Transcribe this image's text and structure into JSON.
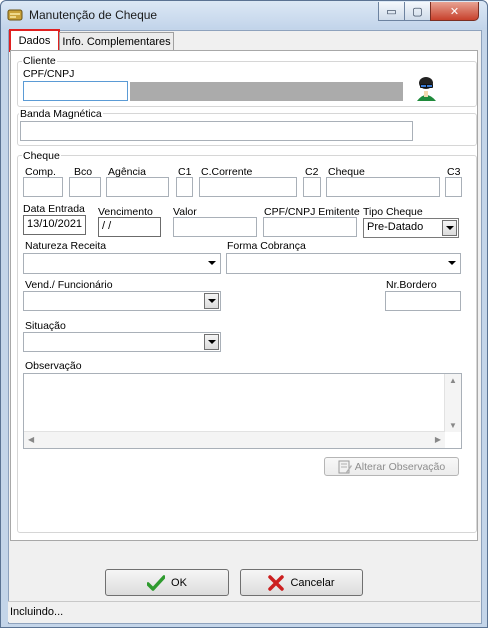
{
  "window": {
    "title": "Manutenção de Cheque",
    "min_glyph": "▭",
    "max_glyph": "▢",
    "close_glyph": "✕"
  },
  "tabs": [
    {
      "label": "Dados",
      "active": true
    },
    {
      "label": "Info. Complementares",
      "active": false
    }
  ],
  "cliente": {
    "legend": "Cliente",
    "cpf_label": "CPF/CNPJ",
    "cpf_value": "",
    "name_value": ""
  },
  "banda": {
    "legend": "Banda Magnética",
    "value": ""
  },
  "cheque": {
    "legend": "Cheque",
    "comp_label": "Comp.",
    "bco_label": "Bco",
    "agencia_label": "Agência",
    "c1_label": "C1",
    "ccorrente_label": "C.Corrente",
    "c2_label": "C2",
    "cheque_label": "Cheque",
    "c3_label": "C3",
    "data_entrada_label": "Data Entrada",
    "data_entrada_value": "13/10/2021",
    "vencimento_label": "Vencimento",
    "vencimento_value": " /  /",
    "valor_label": "Valor",
    "cpf_emitente_label": "CPF/CNPJ Emitente",
    "tipo_label": "Tipo Cheque",
    "tipo_value": "Pre-Datado",
    "natureza_label": "Natureza Receita",
    "forma_label": "Forma Cobrança",
    "vend_label": "Vend./ Funcionário",
    "bordero_label": "Nr.Bordero",
    "situacao_label": "Situação",
    "observacao_label": "Observação",
    "alterar_obs_label": "Alterar Observação"
  },
  "buttons": {
    "ok_label": "OK",
    "cancel_label": "Cancelar"
  },
  "status": {
    "text": "Incluindo..."
  },
  "colors": {
    "accent_tab": "#e02020",
    "ok_check": "#2e9b2e",
    "cancel_x": "#cc1f1f"
  }
}
